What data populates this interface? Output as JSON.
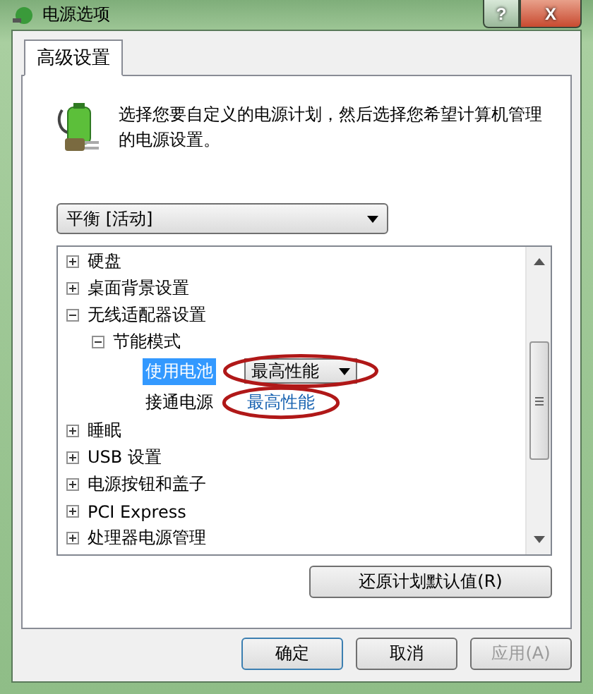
{
  "window": {
    "title": "电源选项",
    "help": "?",
    "close": "X"
  },
  "tabs": [
    {
      "label": "高级设置",
      "selected": true
    }
  ],
  "intro": "选择您要自定义的电源计划，然后选择您希望计算机管理的电源设置。",
  "plan_select": {
    "value": "平衡 [活动]"
  },
  "tree": [
    {
      "label": "硬盘",
      "expanded": false
    },
    {
      "label": "桌面背景设置",
      "expanded": false
    },
    {
      "label": "无线适配器设置",
      "expanded": true,
      "children": [
        {
          "label": "节能模式",
          "expanded": true,
          "children": [
            {
              "kind": "setting",
              "label": "使用电池",
              "value": "最高性能",
              "selected": true,
              "circled": true
            },
            {
              "kind": "setting",
              "label": "接通电源",
              "value": "最高性能",
              "selected": false,
              "circled": true
            }
          ]
        }
      ]
    },
    {
      "label": "睡眠",
      "expanded": false
    },
    {
      "label": "USB 设置",
      "expanded": false
    },
    {
      "label": "电源按钮和盖子",
      "expanded": false
    },
    {
      "label": "PCI Express",
      "expanded": false
    },
    {
      "label": "处理器电源管理",
      "expanded": false
    }
  ],
  "restore_button": "还原计划默认值(R)",
  "buttons": [
    {
      "label": "确定",
      "disabled": false,
      "default": true
    },
    {
      "label": "取消",
      "disabled": false,
      "default": false
    },
    {
      "label": "应用(A)",
      "disabled": true,
      "default": false
    }
  ]
}
